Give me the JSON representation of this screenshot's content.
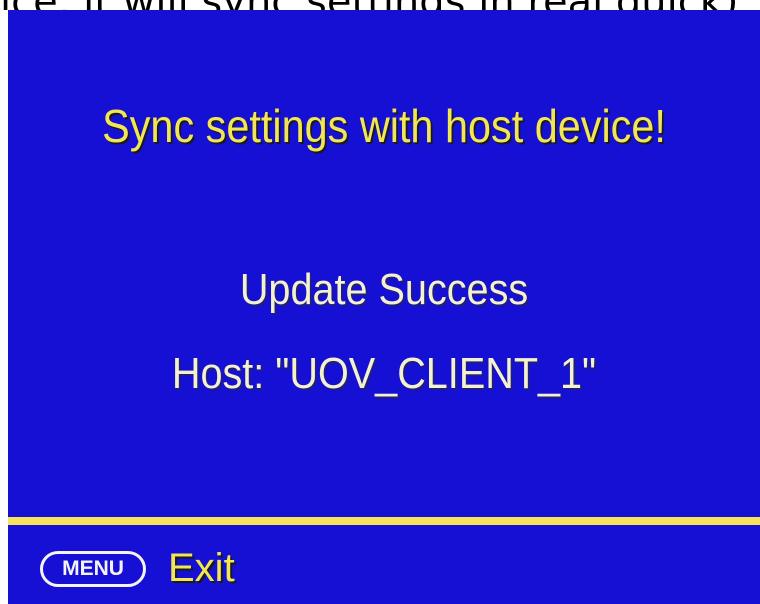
{
  "caption": {
    "text": "ice, it will sync settings in real quick)"
  },
  "osd": {
    "title": "Sync settings with host device!",
    "status": "Update Success",
    "host_line": "Host: \"UOV_CLIENT_1\"",
    "footer": {
      "menu_key_label": "MENU",
      "exit_label": "Exit"
    }
  },
  "colors": {
    "background": "#1510d3",
    "title": "#f2e655",
    "body_text": "#f4f1cf",
    "divider": "#f6e35a",
    "key_outline": "#f4f4f4"
  }
}
